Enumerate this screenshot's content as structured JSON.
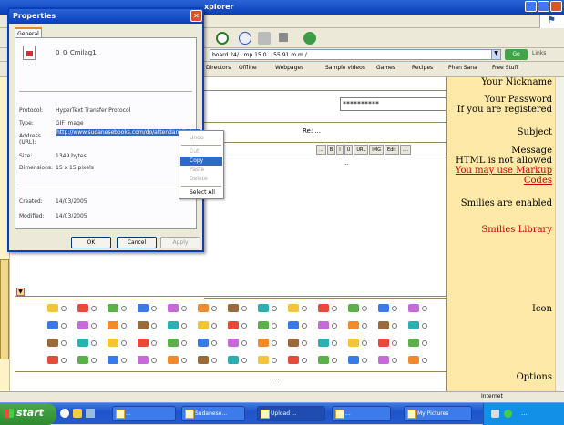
{
  "ie": {
    "title": "xplorer",
    "address": "board 24/...mp 15.0... 55.91.m.m /",
    "go_label": "Go",
    "links_label": "Links",
    "links_bar": [
      "Directors",
      "Offline",
      "Webpages",
      "Sample videos",
      "Games",
      "Recipes",
      "Phan Sana",
      "Free Stuff"
    ]
  },
  "form": {
    "nickname_label": "Your Nickname",
    "password_field": "**********",
    "password_label": "Your Password",
    "password_hint": "If you are registered",
    "subject_value": "Re: ...",
    "subject_label": "Subject",
    "message_label": "Message",
    "html_note": "HTML is not allowed",
    "markup_note": "You may use Markup Codes",
    "smilies_note": "Smilies are enabled",
    "smilies_link": "Smilies Library",
    "editor_buttons": [
      "...",
      "B",
      "I",
      "U",
      "URL",
      "IMG",
      "Edit",
      "...."
    ],
    "editor_text": "...",
    "icon_label": "Icon",
    "options_label": "Options",
    "options_text": "..."
  },
  "dialog": {
    "title": "Properties",
    "tab": "General",
    "filename": "0_0_Cmilag1",
    "rows": [
      {
        "label": "Protocol:",
        "value": "HyperText Transfer Protocol"
      },
      {
        "label": "Type:",
        "value": "GIF Image"
      },
      {
        "label": "Address (URL):",
        "value": "http://www.sudanesebooks.com/do/attendant/0_0_..."
      },
      {
        "label": "Size:",
        "value": "1349 bytes"
      },
      {
        "label": "Dimensions:",
        "value": "15 x 15 pixels"
      },
      {
        "label": "Created:",
        "value": "14/03/2005"
      },
      {
        "label": "Modified:",
        "value": "14/03/2005"
      }
    ],
    "ok": "OK",
    "cancel": "Cancel",
    "apply": "Apply"
  },
  "context_menu": [
    "Undo",
    "Cut",
    "Copy",
    "Paste",
    "Delete",
    "Select All"
  ],
  "status": {
    "zone": "Internet"
  },
  "taskbar": {
    "start": "start",
    "buttons": [
      "...",
      "Sudanese...",
      "Upload ...",
      "...",
      "My Pictures"
    ],
    "clock": "..."
  },
  "colors": {
    "form_label_bg": "#ffe9a8",
    "titlebar": "#0a3fb8",
    "selection": "#316ac5"
  }
}
